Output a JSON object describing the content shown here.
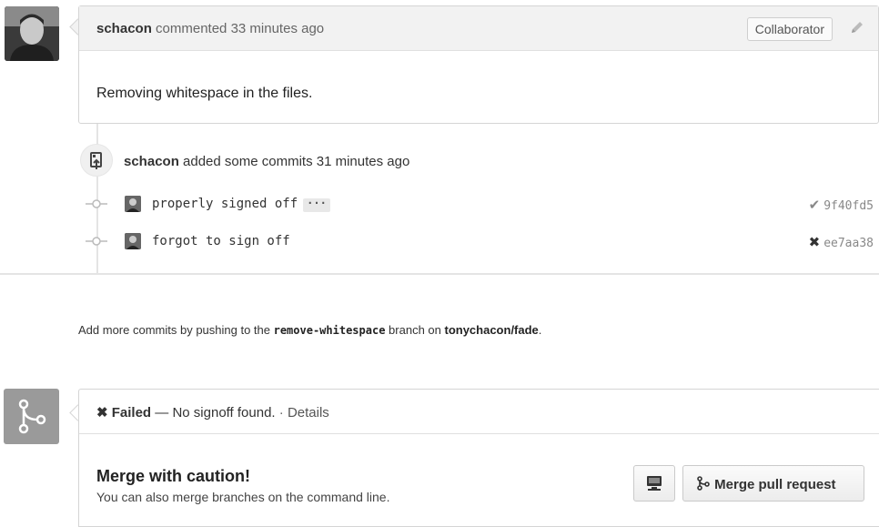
{
  "comment": {
    "author": "schacon",
    "action": "commented 33 minutes ago",
    "role_badge": "Collaborator",
    "body": "Removing whitespace in the files."
  },
  "push_event": {
    "author": "schacon",
    "action": "added some commits 31 minutes ago"
  },
  "commits": [
    {
      "message": "properly signed off",
      "has_ellipsis": true,
      "ellipsis": "···",
      "status_symbol": "✔",
      "sha": "9f40fd5"
    },
    {
      "message": "forgot to sign off",
      "has_ellipsis": false,
      "status_symbol": "✖",
      "sha": "ee7aa38"
    }
  ],
  "hint": {
    "prefix": "Add more commits by pushing to the ",
    "branch": "remove-whitespace",
    "middle": " branch on ",
    "repo": "tonychacon/fade",
    "suffix": "."
  },
  "merge": {
    "status_symbol": "✖",
    "status_label": "Failed",
    "status_dash": " — ",
    "status_text": "No signoff found.",
    "status_sep": " · ",
    "details_link": "Details",
    "title": "Merge with caution!",
    "subtitle": "You can also merge branches on the command line.",
    "merge_button": "Merge pull request"
  },
  "icons": {
    "edit": "pencil-icon",
    "push": "repo-push-icon",
    "commit_node": "git-commit-icon",
    "merge": "git-merge-icon",
    "desktop": "desktop-icon"
  },
  "colors": {
    "header_bg": "#f2f2f2",
    "border": "#d5d5d5",
    "merge_icon_bg": "#9a9a9a"
  }
}
